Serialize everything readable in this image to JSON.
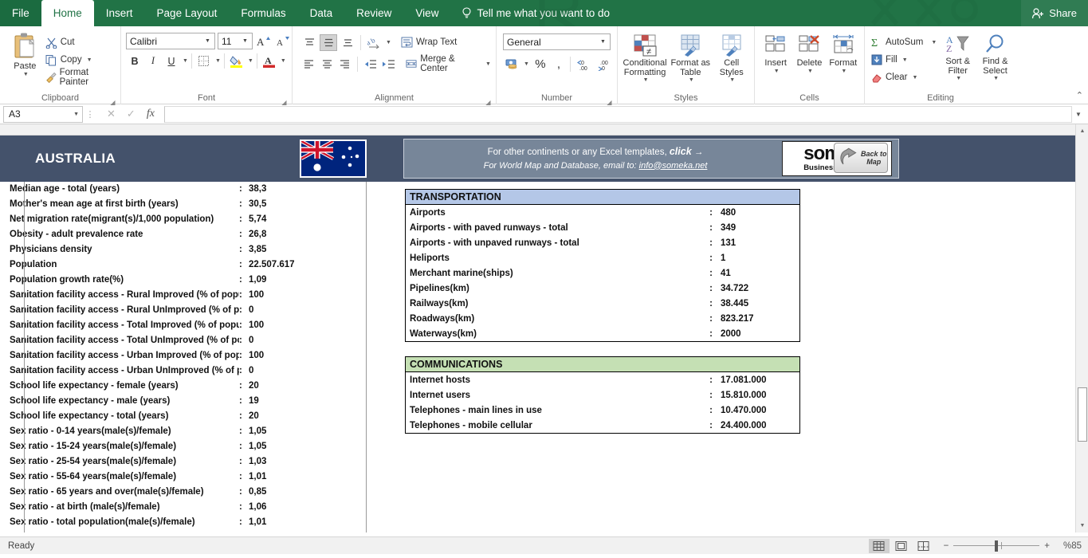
{
  "window": {
    "tabs": [
      {
        "label": "File",
        "state": "file"
      },
      {
        "label": "Home",
        "state": "active"
      },
      {
        "label": "Insert",
        "state": "normal"
      },
      {
        "label": "Page Layout",
        "state": "normal"
      },
      {
        "label": "Formulas",
        "state": "normal"
      },
      {
        "label": "Data",
        "state": "normal"
      },
      {
        "label": "Review",
        "state": "normal"
      },
      {
        "label": "View",
        "state": "normal"
      }
    ],
    "tell_me": "Tell me what you want to do",
    "share": "Share"
  },
  "ribbon": {
    "clipboard": {
      "label": "Clipboard",
      "paste": "Paste",
      "cut": "Cut",
      "copy": "Copy",
      "format_painter": "Format Painter"
    },
    "font": {
      "label": "Font",
      "font_name": "Calibri",
      "font_size": "11",
      "grow": "A",
      "shrink": "A",
      "bold": "B",
      "italic": "I",
      "underline": "U"
    },
    "alignment": {
      "label": "Alignment",
      "wrap_text": "Wrap Text",
      "merge_center": "Merge & Center"
    },
    "number": {
      "label": "Number",
      "format": "General",
      "percent": "%",
      "comma": ","
    },
    "styles": {
      "label": "Styles",
      "conditional_formatting": "Conditional Formatting",
      "format_as_table": "Format as Table",
      "cell_styles": "Cell Styles"
    },
    "cells": {
      "label": "Cells",
      "insert": "Insert",
      "delete": "Delete",
      "format": "Format"
    },
    "editing": {
      "label": "Editing",
      "autosum": "AutoSum",
      "fill": "Fill",
      "clear": "Clear",
      "sort_filter": "Sort & Filter",
      "find_select": "Find & Select"
    }
  },
  "formula_bar": {
    "name_box": "A3",
    "formula": ""
  },
  "sheet": {
    "banner": {
      "country": "AUSTRALIA",
      "flag_alt": "australia-flag"
    },
    "promo": {
      "line1_prefix": "For other continents or any Excel templates,",
      "line1_click": "click",
      "line1_arrow": "→",
      "line2_prefix": "For World Map and Database, email to:",
      "line2_email": "info@someka.net",
      "logo_word": "someka",
      "logo_sub": "Business Analysis",
      "back_button_line1": "Back to",
      "back_button_line2": "Map"
    },
    "left_rows": [
      {
        "label": "Median age - total (years)",
        "value": "38,3"
      },
      {
        "label": "Mother's mean age at first birth (years)",
        "value": "30,5"
      },
      {
        "label": "Net migration rate(migrant(s)/1,000 population)",
        "value": "5,74"
      },
      {
        "label": "Obesity - adult prevalence rate",
        "value": "26,8"
      },
      {
        "label": "Physicians density",
        "value": "3,85"
      },
      {
        "label": "Population",
        "value": "22.507.617"
      },
      {
        "label": "Population growth rate(%)",
        "value": "1,09"
      },
      {
        "label": "Sanitation facility access - Rural Improved (% of population)",
        "value": "100"
      },
      {
        "label": "Sanitation facility access - Rural UnImproved (% of population)",
        "value": "0"
      },
      {
        "label": "Sanitation facility access - Total Improved (% of population)",
        "value": "100"
      },
      {
        "label": "Sanitation facility access - Total UnImproved (% of population)",
        "value": "0"
      },
      {
        "label": "Sanitation facility access - Urban Improved (% of population)",
        "value": "100"
      },
      {
        "label": "Sanitation facility access - Urban UnImproved (% of population)",
        "value": "0"
      },
      {
        "label": "School life expectancy - female (years)",
        "value": "20"
      },
      {
        "label": "School life expectancy - male (years)",
        "value": "19"
      },
      {
        "label": "School life expectancy - total (years)",
        "value": "20"
      },
      {
        "label": "Sex ratio - 0-14 years(male(s)/female)",
        "value": "1,05"
      },
      {
        "label": "Sex ratio - 15-24 years(male(s)/female)",
        "value": "1,05"
      },
      {
        "label": "Sex ratio - 25-54 years(male(s)/female)",
        "value": "1,03"
      },
      {
        "label": "Sex ratio - 55-64 years(male(s)/female)",
        "value": "1,01"
      },
      {
        "label": "Sex ratio - 65 years and over(male(s)/female)",
        "value": "0,85"
      },
      {
        "label": "Sex ratio - at birth (male(s)/female)",
        "value": "1,06"
      },
      {
        "label": "Sex ratio - total population(male(s)/female)",
        "value": "1,01"
      }
    ],
    "tables": [
      {
        "title": "TRANSPORTATION",
        "header_color": "#B4C7E7",
        "rows": [
          {
            "label": "Airports",
            "value": "480"
          },
          {
            "label": "Airports - with paved runways - total",
            "value": "349"
          },
          {
            "label": "Airports - with unpaved runways - total",
            "value": "131"
          },
          {
            "label": "Heliports",
            "value": "1"
          },
          {
            "label": "Merchant marine(ships)",
            "value": "41"
          },
          {
            "label": "Pipelines(km)",
            "value": "34.722"
          },
          {
            "label": "Railways(km)",
            "value": "38.445"
          },
          {
            "label": "Roadways(km)",
            "value": "823.217"
          },
          {
            "label": "Waterways(km)",
            "value": "2000"
          }
        ]
      },
      {
        "title": "COMMUNICATIONS",
        "header_color": "#C5E0B4",
        "rows": [
          {
            "label": "Internet hosts",
            "value": "17.081.000"
          },
          {
            "label": "Internet users",
            "value": "15.810.000"
          },
          {
            "label": "Telephones - main lines in use",
            "value": "10.470.000"
          },
          {
            "label": "Telephones - mobile cellular",
            "value": "24.400.000"
          }
        ]
      }
    ]
  },
  "status_bar": {
    "ready": "Ready",
    "zoom": "%85",
    "view_normal": "normal-view",
    "view_page_layout": "page-layout-view",
    "view_page_break": "page-break-view",
    "zoom_out": "−",
    "zoom_in": "+"
  },
  "colors": {
    "ribbon_green": "#217346",
    "banner_slate": "#44526B",
    "promo_slate": "#778699",
    "transportation_header": "#B4C7E7",
    "communications_header": "#C5E0B4"
  }
}
